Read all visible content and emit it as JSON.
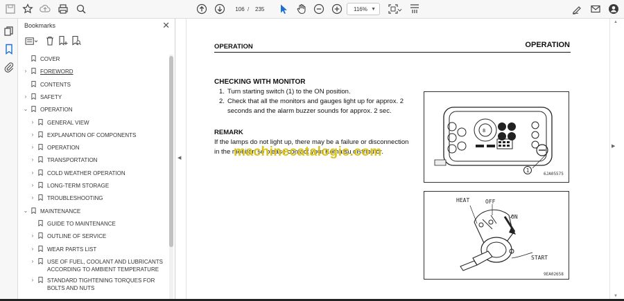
{
  "toolbar": {
    "page_current": "106",
    "page_sep": "/",
    "page_total": "235",
    "zoom": "116%",
    "icons": [
      "save-icon",
      "bookmark-star-icon",
      "upload-icon",
      "print-icon",
      "zoom-search-icon",
      "page-up-icon",
      "page-down-icon",
      "pointer-icon",
      "hand-icon",
      "zoom-out-icon",
      "zoom-in-icon",
      "fit-page-icon",
      "scroll-mode-icon",
      "sign-icon",
      "mail-icon",
      "account-icon"
    ]
  },
  "bookmarks": {
    "title": "Bookmarks",
    "close": "✕",
    "items": [
      {
        "label": "COVER",
        "level": 0,
        "chevron": ""
      },
      {
        "label": "FOREWORD",
        "level": 0,
        "chevron": "›",
        "underline": true
      },
      {
        "label": "CONTENTS",
        "level": 0,
        "chevron": ""
      },
      {
        "label": "SAFETY",
        "level": 0,
        "chevron": "›"
      },
      {
        "label": "OPERATION",
        "level": 0,
        "chevron": "⌄"
      },
      {
        "label": "GENERAL VIEW",
        "level": 1,
        "chevron": "›"
      },
      {
        "label": "EXPLANATION OF COMPONENTS",
        "level": 1,
        "chevron": "›"
      },
      {
        "label": "OPERATION",
        "level": 1,
        "chevron": "›"
      },
      {
        "label": "TRANSPORTATION",
        "level": 1,
        "chevron": "›"
      },
      {
        "label": "COLD WEATHER OPERATION",
        "level": 1,
        "chevron": "›"
      },
      {
        "label": "LONG-TERM STORAGE",
        "level": 1,
        "chevron": "›"
      },
      {
        "label": "TROUBLESHOOTING",
        "level": 1,
        "chevron": "›"
      },
      {
        "label": "MAINTENANCE",
        "level": 0,
        "chevron": "⌄"
      },
      {
        "label": "GUIDE TO MAINTENANCE",
        "level": 1,
        "chevron": ""
      },
      {
        "label": "OUTLINE OF SERVICE",
        "level": 1,
        "chevron": "›"
      },
      {
        "label": "WEAR PARTS LIST",
        "level": 1,
        "chevron": "›"
      },
      {
        "label": "USE OF FUEL, COOLANT AND LUBRICANTS",
        "label2": "ACCORDING TO AMBIENT TEMPERATURE",
        "level": 1,
        "chevron": "›"
      },
      {
        "label": "STANDARD TIGHTENING TORQUES FOR",
        "label2": "BOLTS AND NUTS",
        "level": 1,
        "chevron": "›"
      }
    ]
  },
  "page": {
    "header_left": "OPERATION",
    "header_right": "OPERATION",
    "section_title": "CHECKING WITH MONITOR",
    "step1_num": "1.",
    "step1": "Turn starting switch (1) to the ON position.",
    "step2_num": "2.",
    "step2_line1": "Check that all the monitors and gauges light up for approx. 2",
    "step2_line2": "seconds and the alarm buzzer sounds for approx. 2 sec.",
    "remark_title": "REMARK",
    "remark_line1": "If the lamps do not light up, there may be a failure or disconnection",
    "remark_line2": "in the monitor, so please contact your Komatsu distributor.",
    "watermark": "machinecatalogic.com",
    "fig1_callout": "1",
    "fig1_code": "6JA05575",
    "fig2_heat": "HEAT",
    "fig2_off": "OFF",
    "fig2_on": "ON",
    "fig2_start": "START",
    "fig2_code": "9EA02658"
  }
}
